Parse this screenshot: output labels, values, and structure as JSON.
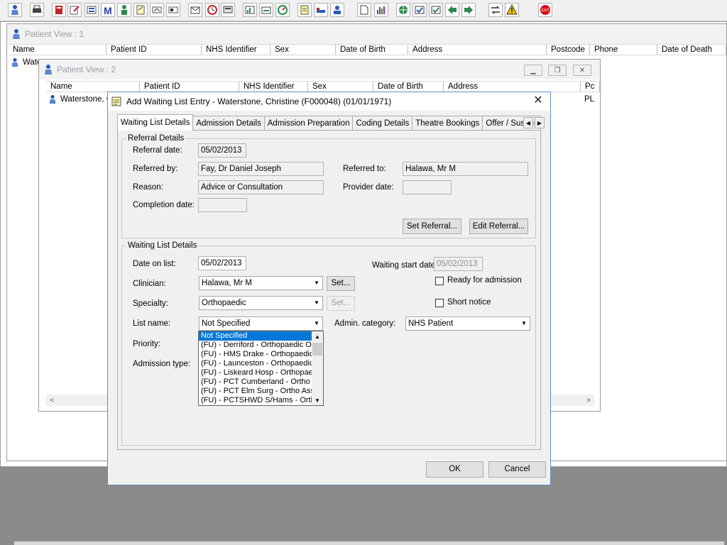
{
  "toolbar": {
    "icons": [
      "patient-icon",
      "printer-icon",
      "book-icon",
      "edit-icon",
      "form-icon",
      "m-icon",
      "person-icon",
      "notes-icon",
      "flag-icon",
      "card-icon",
      "mail-icon",
      "clock-icon",
      "screen-icon",
      "chart-icon",
      "folder-icon",
      "dial-icon",
      "note-icon",
      "bed-icon",
      "doctor-icon",
      "document-icon",
      "barchart-icon",
      "globe-icon",
      "checklist-icon",
      "checkmark-icon",
      "transfer-icon",
      "return-icon",
      "swap-icon",
      "warning-icon",
      "exit-icon"
    ],
    "exit_label": "EXIT"
  },
  "patient_view_1": {
    "title": "Patient View : 1",
    "columns": [
      "Name",
      "Patient ID",
      "NHS Identifier",
      "Sex",
      "Date of Birth",
      "Address",
      "Postcode",
      "Phone",
      "Date of Death"
    ],
    "row_name": "Wate"
  },
  "patient_view_2": {
    "title": "Patient View : 2",
    "columns": [
      "Name",
      "Patient ID",
      "NHS Identifier",
      "Sex",
      "Date of Birth",
      "Address",
      "Pc"
    ],
    "row_name": "Waterstone, C",
    "row_pc": "PL"
  },
  "dialog": {
    "title": "Add Waiting List Entry - Waterstone, Christine (F000048) (01/01/1971)",
    "tabs": [
      "Waiting List Details",
      "Admission Details",
      "Admission Preparation",
      "Coding Details",
      "Theatre Bookings",
      "Offer / Suspend"
    ],
    "referral": {
      "group_label": "Referral Details",
      "referral_date_label": "Referral date:",
      "referral_date": "05/02/2013",
      "referred_by_label": "Referred by:",
      "referred_by": "Fay, Dr Daniel Joseph",
      "referred_to_label": "Referred to:",
      "referred_to": "Halawa, Mr M",
      "reason_label": "Reason:",
      "reason": "Advice or Consultation",
      "provider_date_label": "Provider date:",
      "provider_date": "",
      "completion_date_label": "Completion date:",
      "completion_date": "",
      "set_referral": "Set Referral...",
      "edit_referral": "Edit Referral..."
    },
    "waiting": {
      "group_label": "Waiting List Details",
      "date_on_list_label": "Date on list:",
      "date_on_list": "05/02/2013",
      "waiting_start_label": "Waiting start date:",
      "waiting_start": "05/02/2013",
      "ready_label": "Ready for admission",
      "short_notice_label": "Short notice",
      "clinician_label": "Clinician:",
      "clinician": "Halawa, Mr M",
      "specialty_label": "Specialty:",
      "specialty": "Orthopaedic",
      "set_label": "Set...",
      "list_name_label": "List name:",
      "list_name": "Not Specified",
      "admin_category_label": "Admin. category:",
      "admin_category": "NHS Patient",
      "priority_label": "Priority:",
      "admission_type_label": "Admission type:",
      "list_options": [
        "Not Specified",
        "(FU) - Derriford - Orthopaedic OPD",
        "(FU) - HMS Drake - Orthopaedic",
        "(FU) - Launceston - Orthopaedic",
        "(FU) - Liskeard Hosp - Orthopaedic",
        "(FU) - PCT Cumberland - Ortho Assess",
        "(FU) - PCT Elm Surg - Ortho Assess",
        "(FU) - PCTSHWD S/Hams - Ortho"
      ]
    },
    "ok": "OK",
    "cancel": "Cancel"
  }
}
